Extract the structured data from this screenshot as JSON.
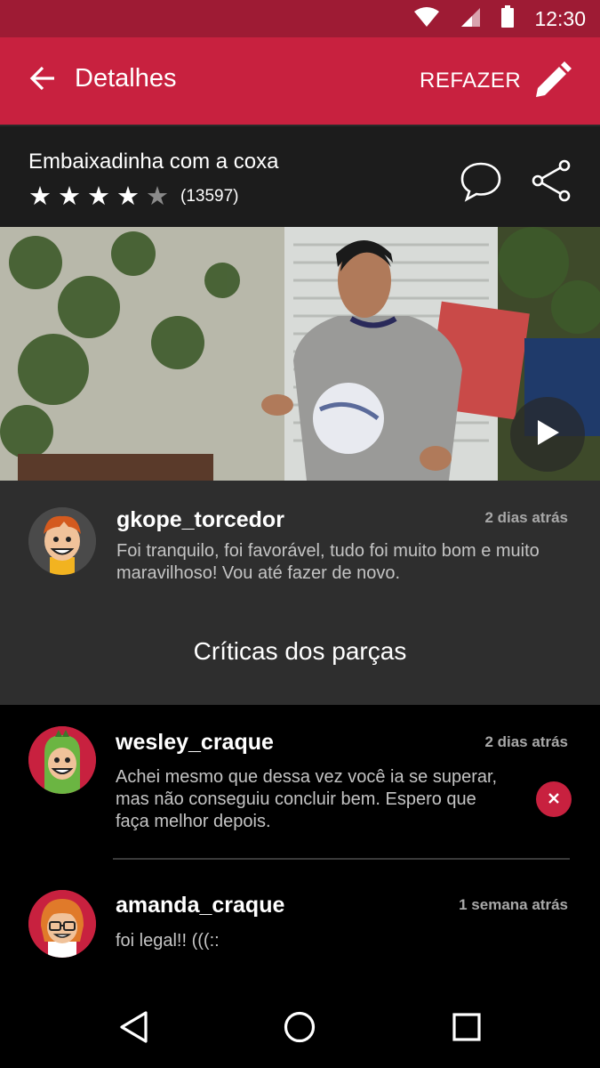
{
  "status_bar": {
    "time": "12:30",
    "icons": [
      "wifi-icon",
      "signal-icon",
      "battery-icon"
    ]
  },
  "app_bar": {
    "title": "Detalhes",
    "redo_label": "REFAZER",
    "back_icon": "arrow-back-icon",
    "edit_icon": "pencil-icon"
  },
  "video": {
    "title": "Embaixadinha com a coxa",
    "rating": 4,
    "rating_max": 5,
    "rating_count": "(13597)",
    "actions": [
      "comment-icon",
      "share-icon"
    ]
  },
  "owner_comment": {
    "username": "gkope_torcedor",
    "time": "2 dias atrás",
    "text": "Foi tranquilo, foi favorável, tudo foi muito bom e muito maravilhoso! Vou até fazer de novo."
  },
  "section": {
    "title": "Críticas dos parças"
  },
  "reviews": [
    {
      "username": "wesley_craque",
      "time": "2 dias atrás",
      "text": "Achei mesmo que dessa vez você ia se superar, mas não conseguiu concluir bem. Espero que faça melhor depois."
    },
    {
      "username": "amanda_craque",
      "time": "1 semana atrás",
      "text": "foi legal!! (((::"
    }
  ],
  "colors": {
    "primary": "#c8213f",
    "primary_dark": "#9e1b34",
    "surface": "#2e2e2e"
  }
}
